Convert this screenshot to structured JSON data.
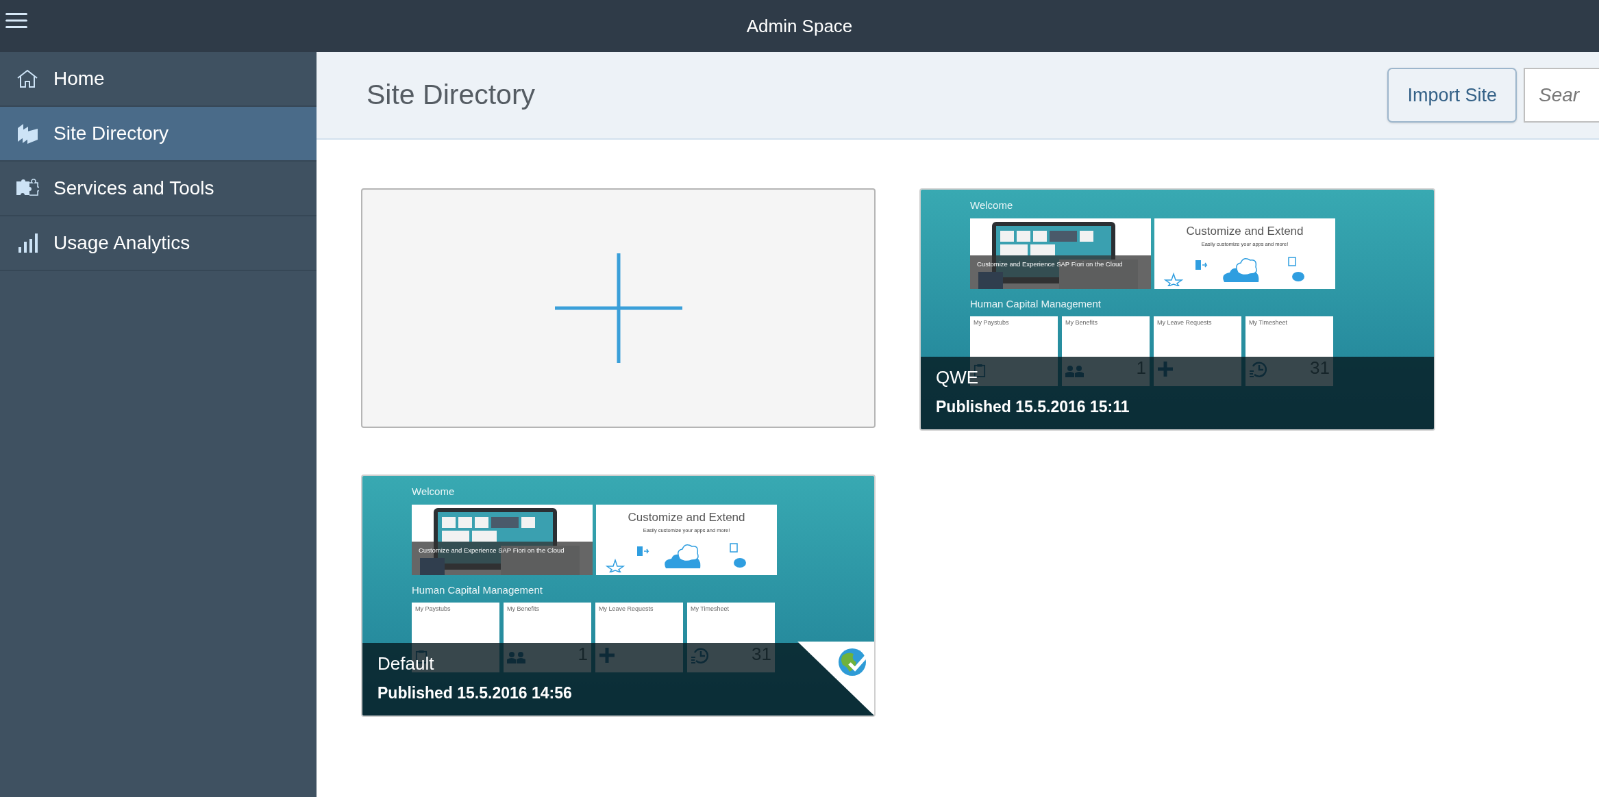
{
  "header": {
    "title": "Admin Space"
  },
  "sidebar": {
    "items": [
      {
        "label": "Home",
        "selected": false
      },
      {
        "label": "Site Directory",
        "selected": true
      },
      {
        "label": "Services and Tools",
        "selected": false
      },
      {
        "label": "Usage Analytics",
        "selected": false
      }
    ]
  },
  "page": {
    "title": "Site Directory",
    "import_button": "Import Site",
    "search": {
      "placeholder": "Sear"
    }
  },
  "sites": [
    {
      "kind": "new"
    },
    {
      "kind": "site",
      "name": "QWE",
      "published": "Published 15.5.2016 15:11",
      "default_badge": false,
      "preview": {
        "heading": "Welcome",
        "feature_caption": "Customize and Experience SAP Fiori on the Cloud",
        "promo_title": "Customize and Extend",
        "promo_subtitle": "Easily customize your apps and more!",
        "section": "Human Capital Management",
        "tiles": [
          {
            "title": "My Paystubs"
          },
          {
            "title": "My Benefits",
            "number": "1"
          },
          {
            "title": "My Leave Requests"
          },
          {
            "title": "My Timesheet",
            "number": "31"
          }
        ]
      }
    },
    {
      "kind": "site",
      "name": "Default",
      "published": "Published 15.5.2016 14:56",
      "default_badge": true,
      "preview": {
        "heading": "Welcome",
        "feature_caption": "Customize and Experience SAP Fiori on the Cloud",
        "promo_title": "Customize and Extend",
        "promo_subtitle": "Easily customize your apps and more!",
        "section": "Human Capital Management",
        "tiles": [
          {
            "title": "My Paystubs"
          },
          {
            "title": "My Benefits",
            "number": "1"
          },
          {
            "title": "My Leave Requests"
          },
          {
            "title": "My Timesheet",
            "number": "31"
          }
        ]
      }
    }
  ]
}
